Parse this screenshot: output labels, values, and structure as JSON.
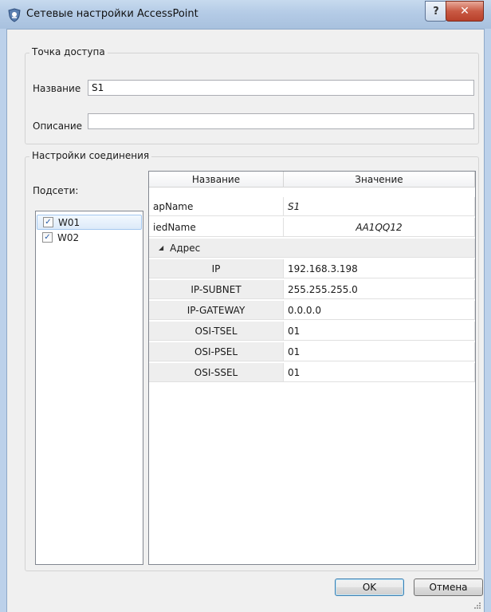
{
  "window": {
    "title": "Сетевые настройки AccessPoint",
    "help_label": "?",
    "close_label": "✕"
  },
  "access_point": {
    "group_title": "Точка доступа",
    "name_label": "Название",
    "name_value": "S1",
    "description_label": "Описание",
    "description_value": ""
  },
  "connection": {
    "group_title": "Настройки соединения",
    "subnets_label": "Подсети:",
    "subnets": [
      {
        "label": "W01",
        "checked": true,
        "selected": true
      },
      {
        "label": "W02",
        "checked": true,
        "selected": false
      }
    ],
    "table": {
      "headers": [
        "Название",
        "Значение"
      ],
      "ap_name": {
        "name": "apName",
        "value": "S1"
      },
      "ied_name": {
        "name": "iedName",
        "value": "AA1QQ12"
      },
      "address_group": "Адрес",
      "address_rows": [
        {
          "name": "IP",
          "value": "192.168.3.198"
        },
        {
          "name": "IP-SUBNET",
          "value": "255.255.255.0"
        },
        {
          "name": "IP-GATEWAY",
          "value": "0.0.0.0"
        },
        {
          "name": "OSI-TSEL",
          "value": "01"
        },
        {
          "name": "OSI-PSEL",
          "value": "01"
        },
        {
          "name": "OSI-SSEL",
          "value": "01"
        }
      ]
    }
  },
  "buttons": {
    "ok": "OK",
    "cancel": "Отмена"
  },
  "icons": {
    "app": "shield-icon",
    "check": "checkmark-icon",
    "expand": "expand-triangle-icon"
  },
  "colors": {
    "titlebar": "#b4cbe6",
    "close": "#c95a44",
    "selection": "#dceaf9",
    "checkmark": "#2a5ea8"
  }
}
